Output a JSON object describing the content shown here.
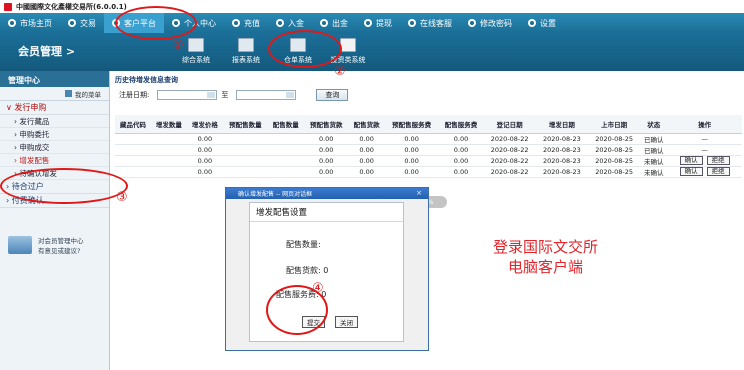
{
  "window": {
    "title": "中國國際文化產權交易所(6.0.0.1)"
  },
  "topnav": [
    {
      "label": "市场主页"
    },
    {
      "label": "交易"
    },
    {
      "label": "客户平台",
      "active": true
    },
    {
      "label": "个人中心"
    },
    {
      "label": "充值"
    },
    {
      "label": "入金"
    },
    {
      "label": "出金"
    },
    {
      "label": "提现"
    },
    {
      "label": "在线客服"
    },
    {
      "label": "修改密码"
    },
    {
      "label": "设置"
    }
  ],
  "toolbar": {
    "section_title": "会员管理  >",
    "tools": [
      {
        "label": "综合系统"
      },
      {
        "label": "报表系统"
      },
      {
        "label": "仓单系统"
      },
      {
        "label": "投资类系统",
        "selected": true
      }
    ]
  },
  "sidebar": {
    "header": "管理中心",
    "favorites": "我的菜单",
    "groups": [
      {
        "label": "发行申购",
        "open": true,
        "items": [
          "发行藏品",
          "申购委托",
          "申购成交",
          "增发配售",
          "待确认增发"
        ]
      },
      {
        "label": "待合过户"
      },
      {
        "label": "付费确认"
      }
    ],
    "help_text": [
      "对会员管理中心",
      "有意见或建议?"
    ]
  },
  "main": {
    "title": "历史待增发信息查询",
    "query": {
      "date_label": "注册日期:",
      "to_label": "至",
      "button": "查询"
    },
    "columns": [
      "藏品代码",
      "增发数量",
      "增发价格",
      "预配售数量",
      "配售数量",
      "预配售货款",
      "配售货款",
      "预配售服务费",
      "配售服务费",
      "登记日期",
      "增发日期",
      "上市日期",
      "状态",
      "操作"
    ],
    "rows": [
      [
        "",
        "",
        "0.00",
        "",
        "",
        "0.00",
        "0.00",
        "0.00",
        "0.00",
        "2020-08-22",
        "2020-08-23",
        "2020-08-25",
        "已确认",
        "—"
      ],
      [
        "",
        "",
        "0.00",
        "",
        "",
        "0.00",
        "0.00",
        "0.00",
        "0.00",
        "2020-08-22",
        "2020-08-23",
        "2020-08-25",
        "已确认",
        "—"
      ],
      [
        "",
        "",
        "0.00",
        "",
        "",
        "0.00",
        "0.00",
        "0.00",
        "0.00",
        "2020-08-22",
        "2020-08-23",
        "2020-08-25",
        "未确认",
        "确认|拒绝"
      ],
      [
        "",
        "",
        "0.00",
        "",
        "",
        "0.00",
        "0.00",
        "0.00",
        "0.00",
        "2020-08-22",
        "2020-08-23",
        "2020-08-25",
        "未确认",
        "确认|拒绝"
      ]
    ]
  },
  "dialog": {
    "title": "确认增发配售 -- 网页对话框",
    "close": "×",
    "section": "增发配售设置",
    "fields": [
      {
        "label": "配售数量:",
        "value": ""
      },
      {
        "label": "配售货款:",
        "value": "0"
      },
      {
        "label": "配售服务费:",
        "value": "0"
      }
    ],
    "submit": "提交",
    "close_btn": "关闭"
  },
  "progress": "100%",
  "watermark": [
    "登录国际文交所",
    "电脑客户端"
  ],
  "annotations": [
    "①",
    "②",
    "③",
    "④"
  ],
  "colors": {
    "nav": "#1a6e95",
    "annotation": "#e01818",
    "sidebar_head": "#2a6f95"
  }
}
